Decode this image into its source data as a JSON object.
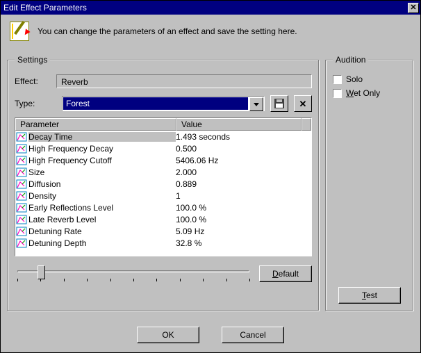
{
  "window": {
    "title": "Edit Effect Parameters"
  },
  "intro_text": "You can change the parameters of an effect and save the setting here.",
  "settings": {
    "legend": "Settings",
    "effect_label": "Effect:",
    "effect_value": "Reverb",
    "type_label": "Type:",
    "type_value": "Forest",
    "columns": {
      "param": "Parameter",
      "value": "Value"
    },
    "params": [
      {
        "name": "Decay Time",
        "value": "1.493 seconds",
        "selected": true
      },
      {
        "name": "High Frequency Decay",
        "value": "0.500",
        "selected": false
      },
      {
        "name": "High Frequency Cutoff",
        "value": "5406.06 Hz",
        "selected": false
      },
      {
        "name": "Size",
        "value": "2.000",
        "selected": false
      },
      {
        "name": "Diffusion",
        "value": "0.889",
        "selected": false
      },
      {
        "name": "Density",
        "value": "1",
        "selected": false
      },
      {
        "name": "Early Reflections Level",
        "value": "100.0 %",
        "selected": false
      },
      {
        "name": "Late Reverb Level",
        "value": "100.0 %",
        "selected": false
      },
      {
        "name": "Detuning Rate",
        "value": "5.09 Hz",
        "selected": false
      },
      {
        "name": "Detuning Depth",
        "value": "32.8 %",
        "selected": false
      }
    ],
    "slider": {
      "position_pct": 11,
      "ticks": 10
    },
    "default_btn": "Default",
    "default_hotkey": "D"
  },
  "audition": {
    "legend": "Audition",
    "solo_label": "Solo",
    "wet_label": "Wet Only",
    "wet_hotkey": "W",
    "solo_checked": false,
    "wet_checked": false,
    "test_btn": "Test",
    "test_hotkey": "T"
  },
  "buttons": {
    "ok": "OK",
    "cancel": "Cancel"
  },
  "icons": {
    "save": "floppy-icon",
    "delete": "x-icon",
    "dropdown": "chevron-down-icon",
    "close": "close-icon",
    "param": "param-icon"
  }
}
